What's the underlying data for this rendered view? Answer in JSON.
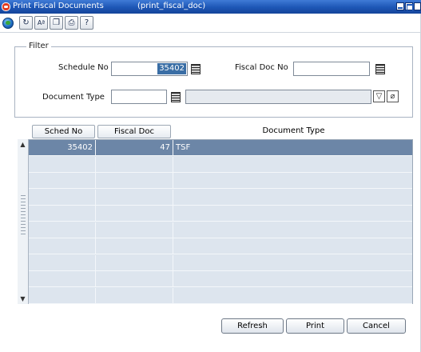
{
  "window": {
    "title": "Print Fiscal Documents",
    "form_name": "(print_fiscal_doc)"
  },
  "toolbar": {
    "buttons": [
      {
        "icon": "globe-icon"
      },
      {
        "icon": "refresh-icon"
      },
      {
        "icon": "spell-check-icon"
      },
      {
        "icon": "copy-icon"
      },
      {
        "icon": "print-icon"
      },
      {
        "icon": "help-icon"
      }
    ]
  },
  "filter": {
    "legend": "Filter",
    "schedule_no_label": "Schedule No",
    "schedule_no_value": "35402",
    "fiscal_doc_no_label": "Fiscal Doc No",
    "fiscal_doc_no_value": "",
    "document_type_label": "Document Type",
    "document_type_value": "",
    "document_type_desc": ""
  },
  "grid": {
    "columns": [
      "Sched No",
      "Fiscal Doc",
      "Document Type"
    ],
    "rows": [
      {
        "sched_no": "35402",
        "fiscal_doc": "47",
        "document_type": "TSF"
      }
    ],
    "selected_row": 0
  },
  "actions": {
    "refresh": "Refresh",
    "print": "Print",
    "cancel": "Cancel"
  },
  "colors": {
    "titlebar": "#1d56b5",
    "selected_row": "#6c86a7",
    "grid_background": "#dde5ee"
  }
}
